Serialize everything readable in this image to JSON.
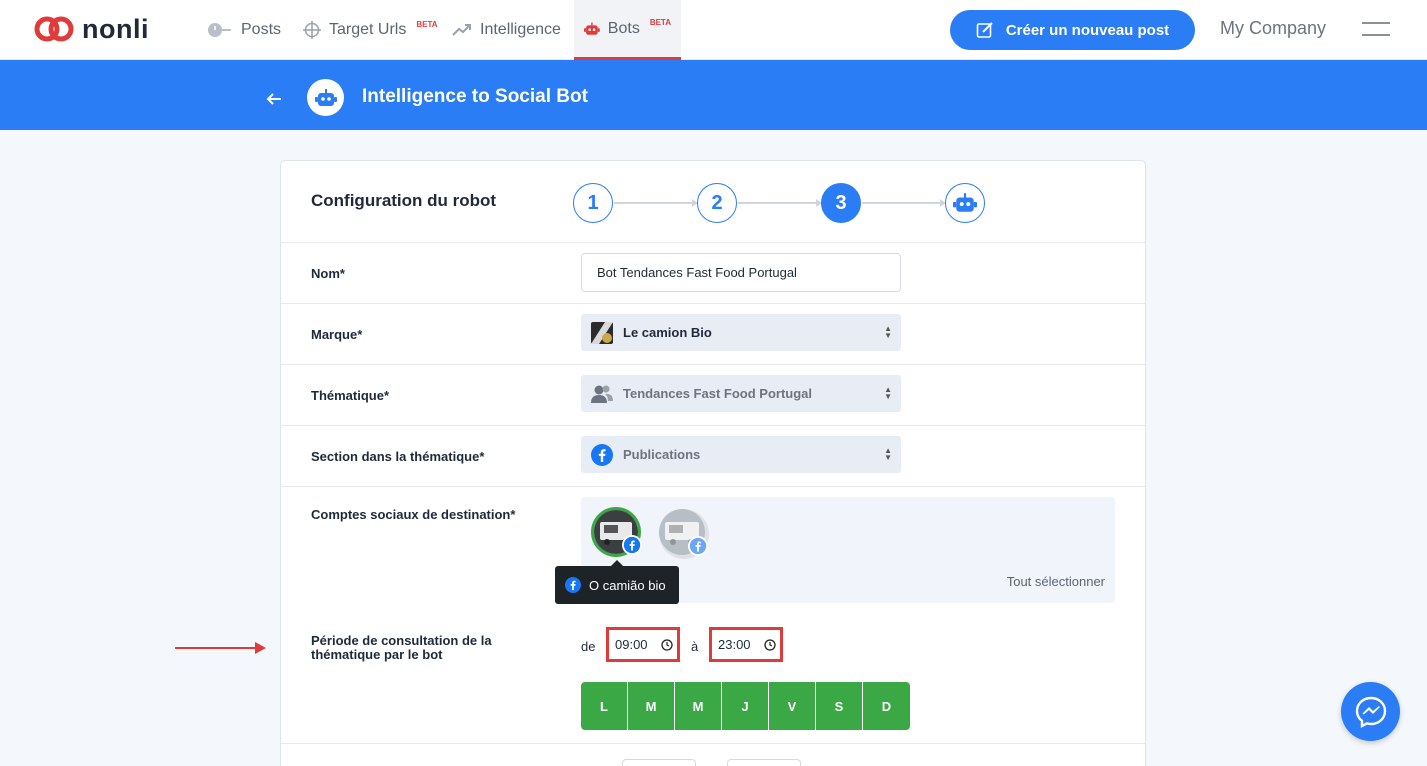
{
  "brand": {
    "name": "nonli",
    "primary_color": "#2a7df4",
    "accent_color": "#e03b3b",
    "success_color": "#3aa845"
  },
  "nav": {
    "items": [
      {
        "label": "Posts",
        "icon": "clock-icon"
      },
      {
        "label": "Target Urls",
        "badge": "BETA",
        "icon": "crosshair-icon"
      },
      {
        "label": "Intelligence",
        "icon": "trend-icon"
      },
      {
        "label": "Bots",
        "badge": "BETA",
        "icon": "robot-icon",
        "active": true
      }
    ],
    "create_button": "Créer un nouveau post",
    "company": "My Company"
  },
  "header": {
    "title": "Intelligence to Social Bot"
  },
  "card": {
    "title": "Configuration du robot",
    "steps": [
      "1",
      "2",
      "3"
    ],
    "current_step": "3"
  },
  "form": {
    "name": {
      "label": "Nom*",
      "value": "Bot Tendances Fast Food Portugal"
    },
    "brand": {
      "label": "Marque*",
      "value": "Le camion Bio"
    },
    "theme": {
      "label": "Thématique*",
      "value": "Tendances Fast Food Portugal"
    },
    "section": {
      "label": "Section dans la thématique*",
      "value": "Publications"
    },
    "accounts": {
      "label": "Comptes sociaux de destination*",
      "select_all": "Tout sélectionner",
      "tooltip": "O camião bio"
    },
    "period": {
      "label": "Période de consultation de la thématique par le bot",
      "from_label": "de",
      "from": "09:00",
      "to_label": "à",
      "to": "23:00",
      "days": [
        "L",
        "M",
        "M",
        "J",
        "V",
        "S",
        "D"
      ]
    }
  }
}
